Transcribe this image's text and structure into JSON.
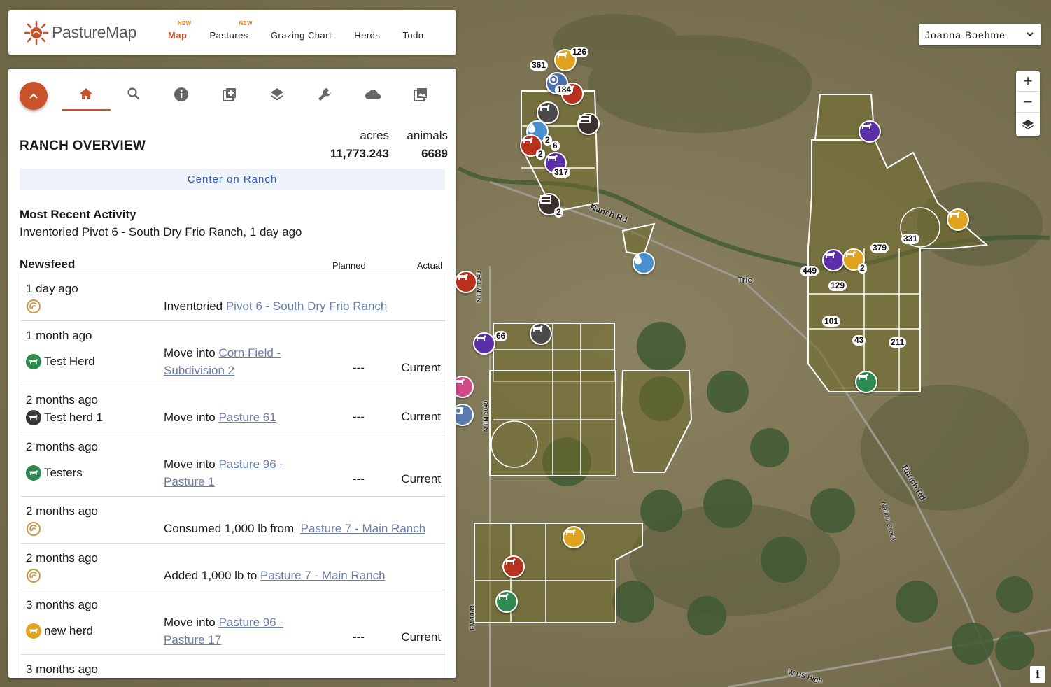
{
  "header": {
    "brand": "PastureMap",
    "nav": [
      {
        "label": "Map",
        "badge": "NEW",
        "active": true
      },
      {
        "label": "Pastures",
        "badge": "NEW",
        "active": false
      },
      {
        "label": "Grazing Chart",
        "badge": "",
        "active": false
      },
      {
        "label": "Herds",
        "badge": "",
        "active": false
      },
      {
        "label": "Todo",
        "badge": "",
        "active": false
      }
    ]
  },
  "user": {
    "name": "Joanna Boehme"
  },
  "zoom": {
    "in": "+",
    "out": "−"
  },
  "map_controls": {
    "info": "i"
  },
  "panel": {
    "tabs": [
      "home-icon",
      "search-icon",
      "info-icon",
      "add-icon",
      "layers-icon",
      "wrench-icon",
      "cloud-icon",
      "photos-icon"
    ],
    "title": "RANCH OVERVIEW",
    "acres_label": "acres",
    "acres_value": "11,773.243",
    "animals_label": "animals",
    "animals_value": "6689",
    "center_button": "Center on Ranch",
    "recent_title": "Most Recent Activity",
    "recent_text": "Inventoried Pivot 6 - South Dry Frio Ranch, 1 day ago",
    "newsfeed_title": "Newsfeed",
    "planned_header": "Planned",
    "actual_header": "Actual",
    "feed": [
      {
        "when": "1 day ago",
        "who": "",
        "icon": "inventory",
        "prefix": "Inventoried ",
        "link": "Pivot 6 - South Dry Frio Ranch",
        "link2": "",
        "planned": "",
        "actual": ""
      },
      {
        "when": "1 month ago",
        "who": "Test Herd",
        "icon": "herd-green",
        "prefix": "Move into ",
        "link": "Corn Field -",
        "link2": "Subdivision 2",
        "planned": "---",
        "actual": "Current"
      },
      {
        "when": "2 months ago",
        "who": "Test herd 1",
        "icon": "herd-dark",
        "prefix": "Move into ",
        "link": "Pasture 61",
        "link2": "",
        "planned": "---",
        "actual": "Current"
      },
      {
        "when": "2 months ago",
        "who": "Testers",
        "icon": "herd-green",
        "prefix": "Move into ",
        "link": "Pasture 96 -",
        "link2": "Pasture 1",
        "planned": "---",
        "actual": "Current"
      },
      {
        "when": "2 months ago",
        "who": "",
        "icon": "inventory",
        "prefix": "Consumed 1,000 lb from  ",
        "link": "Pasture 7 - Main Ranch",
        "link2": "",
        "planned": "",
        "actual": ""
      },
      {
        "when": "2 months ago",
        "who": "",
        "icon": "inventory",
        "prefix": "Added 1,000 lb to ",
        "link": "Pasture 7 - Main Ranch",
        "link2": "",
        "planned": "",
        "actual": ""
      },
      {
        "when": "3 months ago",
        "who": "new herd",
        "icon": "herd-yellow",
        "prefix": "Move into ",
        "link": "Pasture 96 -",
        "link2": "Pasture 17",
        "planned": "---",
        "actual": "Current"
      },
      {
        "when": "3 months ago",
        "who": "",
        "icon": "",
        "prefix": "",
        "link": "",
        "link2": "",
        "planned": "",
        "actual": ""
      }
    ]
  },
  "map": {
    "labels": [
      "Ranch Rd",
      "Trio",
      "Ranch Rd",
      "Nation Creek",
      "W US High",
      "N FM 1049",
      "N FM 1049",
      "FM 1049"
    ],
    "counts": [
      "361",
      "126",
      "184",
      "2",
      "6",
      "2",
      "317",
      "2",
      "331",
      "379",
      "449",
      "2",
      "129",
      "101",
      "43",
      "211",
      "66"
    ]
  },
  "colors": {
    "accent": "#c8532a",
    "link": "#2f5ccc",
    "herd_green": "#2e8b4f",
    "herd_red": "#b8311c",
    "herd_purple": "#5b2fa8",
    "herd_yellow": "#e0a320",
    "herd_dark": "#4a4a4a"
  }
}
